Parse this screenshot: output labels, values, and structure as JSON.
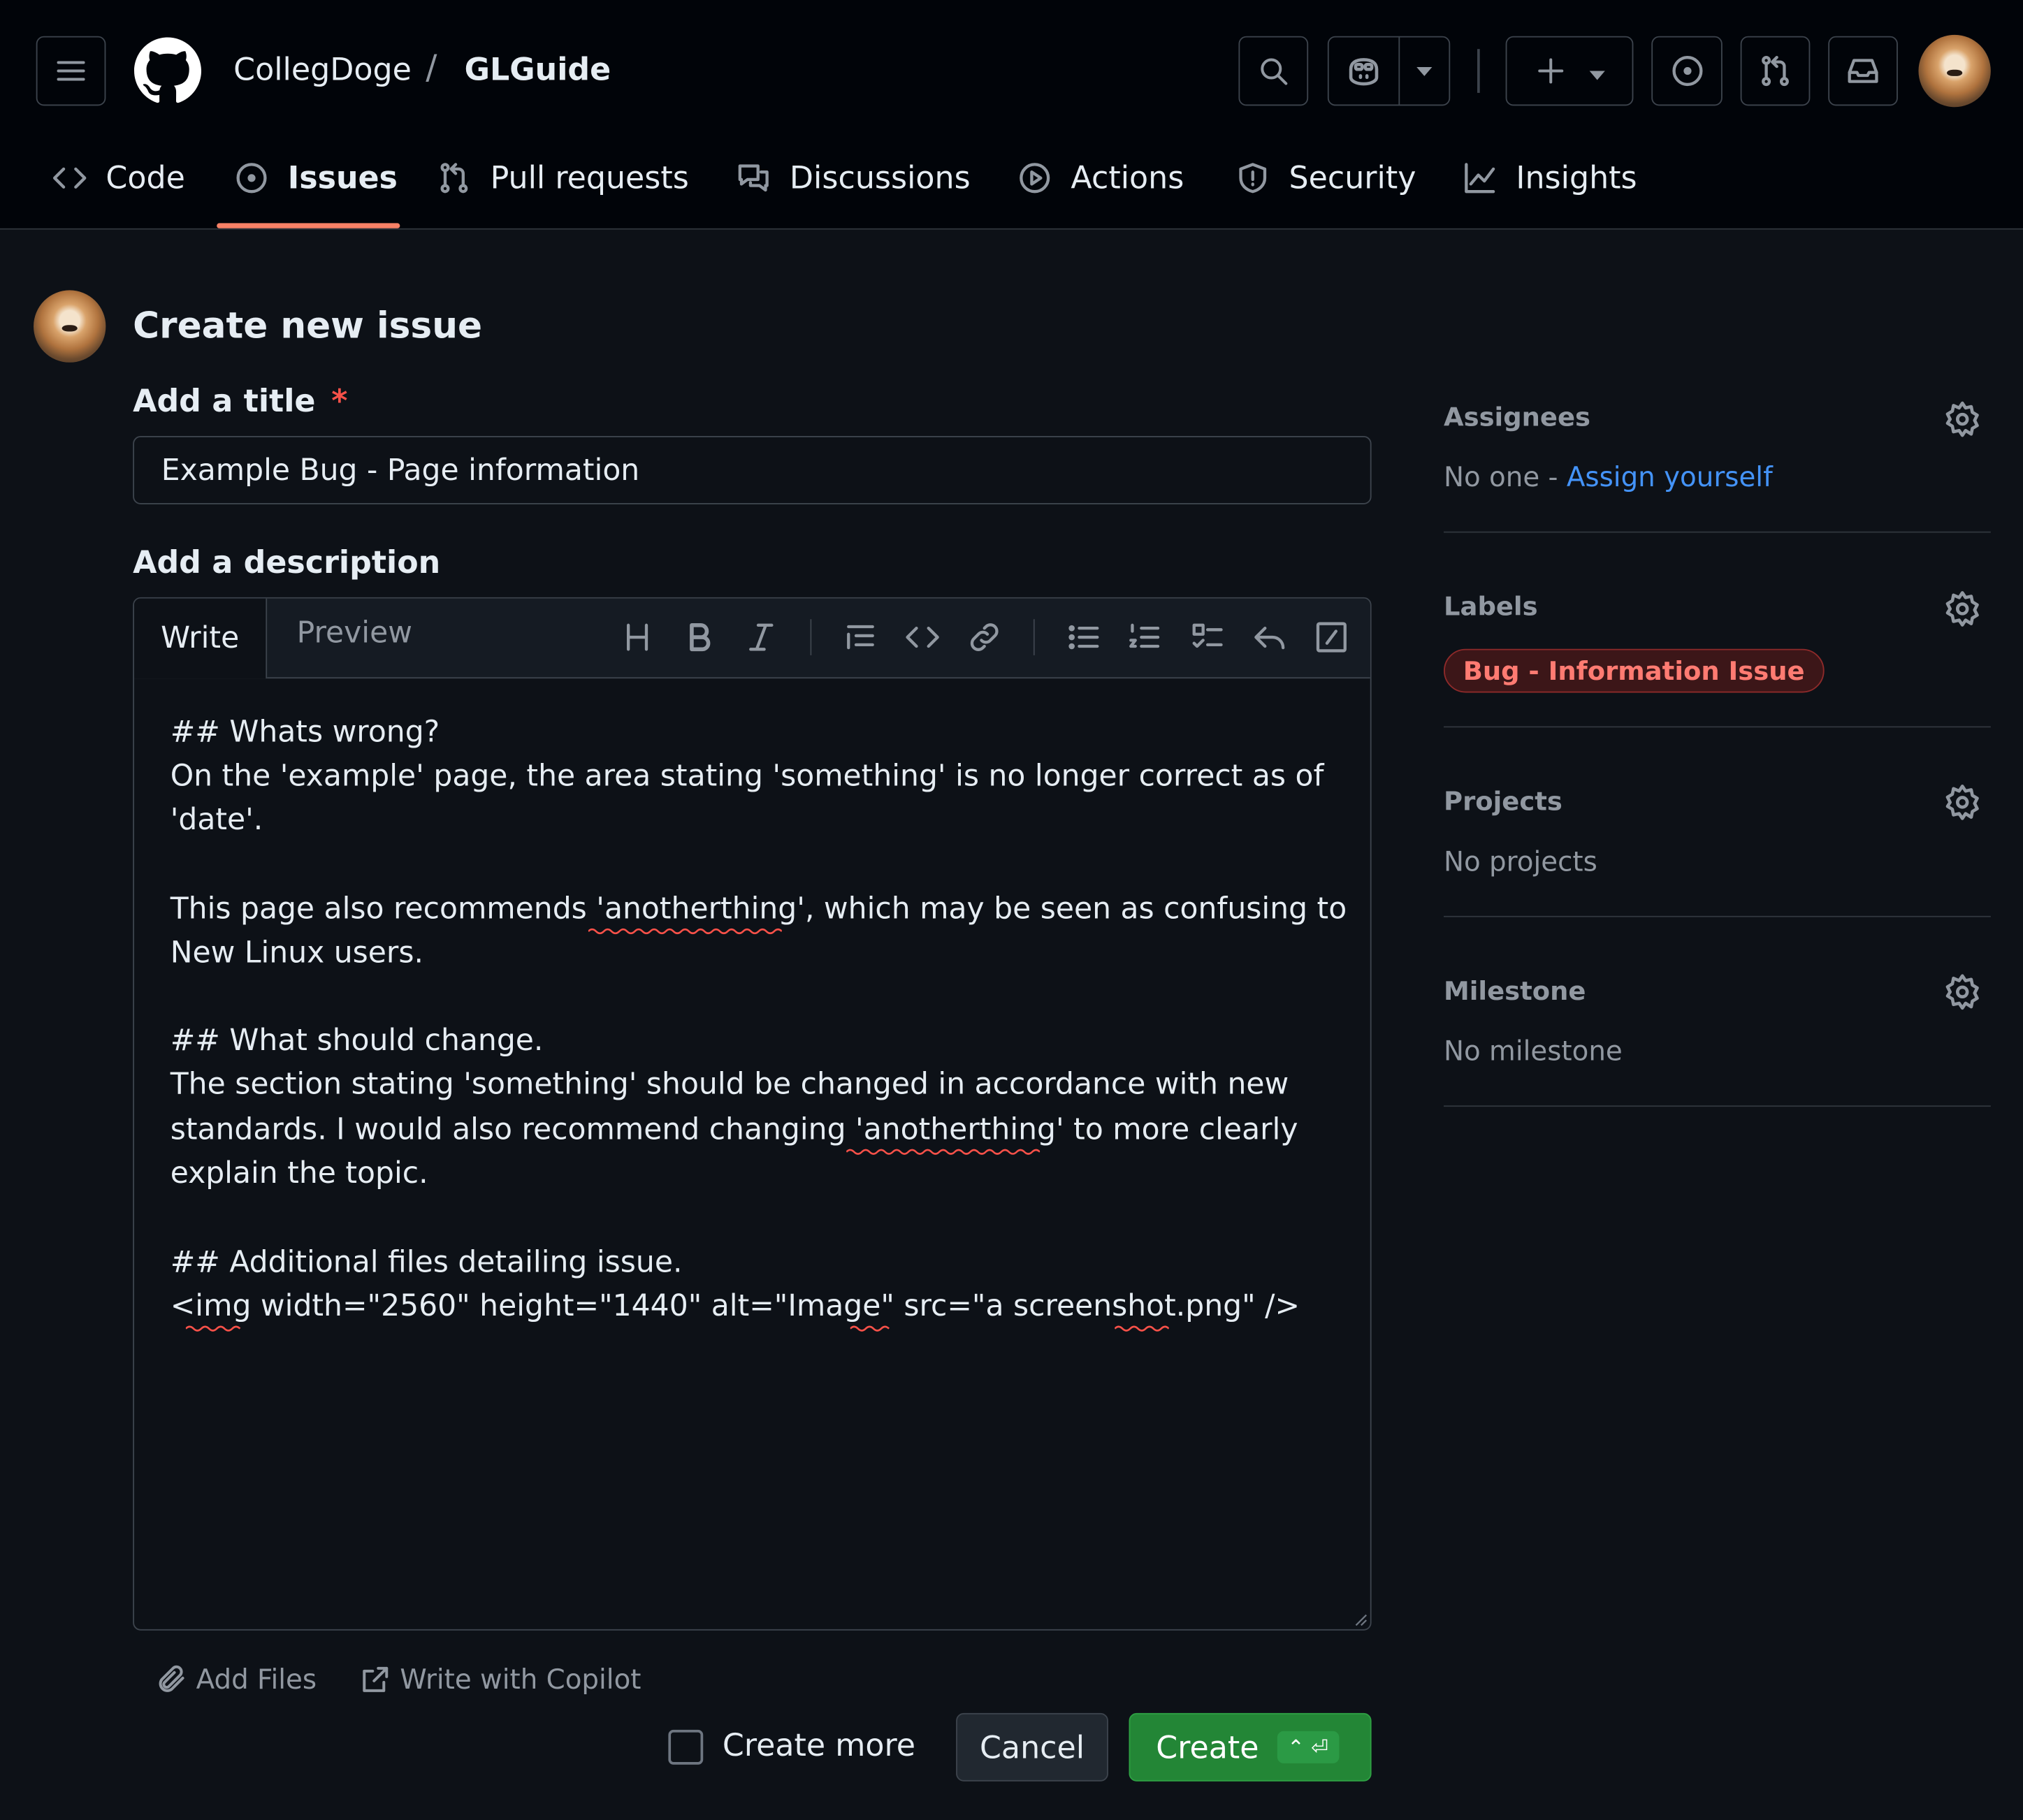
{
  "header": {
    "owner": "CollegDoge",
    "separator": "/",
    "repo": "GLGuide"
  },
  "nav": {
    "tabs": [
      {
        "label": "Code"
      },
      {
        "label": "Issues"
      },
      {
        "label": "Pull requests"
      },
      {
        "label": "Discussions"
      },
      {
        "label": "Actions"
      },
      {
        "label": "Security"
      },
      {
        "label": "Insights"
      }
    ],
    "active_tab": "Issues",
    "active_color": "#f78166"
  },
  "form": {
    "page_title": "Create new issue",
    "title_label": "Add a title",
    "required_mark": "*",
    "title_value": "Example Bug - Page information",
    "description_label": "Add a description",
    "tab_write": "Write",
    "tab_preview": "Preview",
    "body_lines": [
      "## Whats wrong?",
      "On the 'example' page, the area stating 'something' is no longer correct as of",
      "'date'.",
      "",
      "This page also recommends 'anotherthing', which may be seen as confusing to",
      "New Linux users.",
      "",
      "## What should change.",
      "The section stating 'something' should be changed in accordance with new",
      "standards. I would also recommend changing 'anotherthing' to more clearly",
      "explain the topic.",
      "",
      "## Additional files detailing issue.",
      "<img width=\"2560\" height=\"1440\" alt=\"Image\" src=\"a screenshot.png\" />"
    ],
    "add_files": "Add Files",
    "write_with_copilot": "Write with Copilot",
    "create_more": "Create more",
    "cancel": "Cancel",
    "create": "Create",
    "create_shortcut": "⌃ ⏎"
  },
  "sidebar": {
    "assignees_heading": "Assignees",
    "assignees_text": "No one - ",
    "assign_yourself": "Assign yourself",
    "labels_heading": "Labels",
    "label_badge": "Bug - Information Issue",
    "projects_heading": "Projects",
    "projects_text": "No projects",
    "milestone_heading": "Milestone",
    "milestone_text": "No milestone"
  },
  "colors": {
    "background": "#0d1117",
    "header_bg": "#010409",
    "link": "#4493f8",
    "create_button": "#238636",
    "label_fg": "#ff7b72",
    "label_bg": "#3c1618"
  }
}
